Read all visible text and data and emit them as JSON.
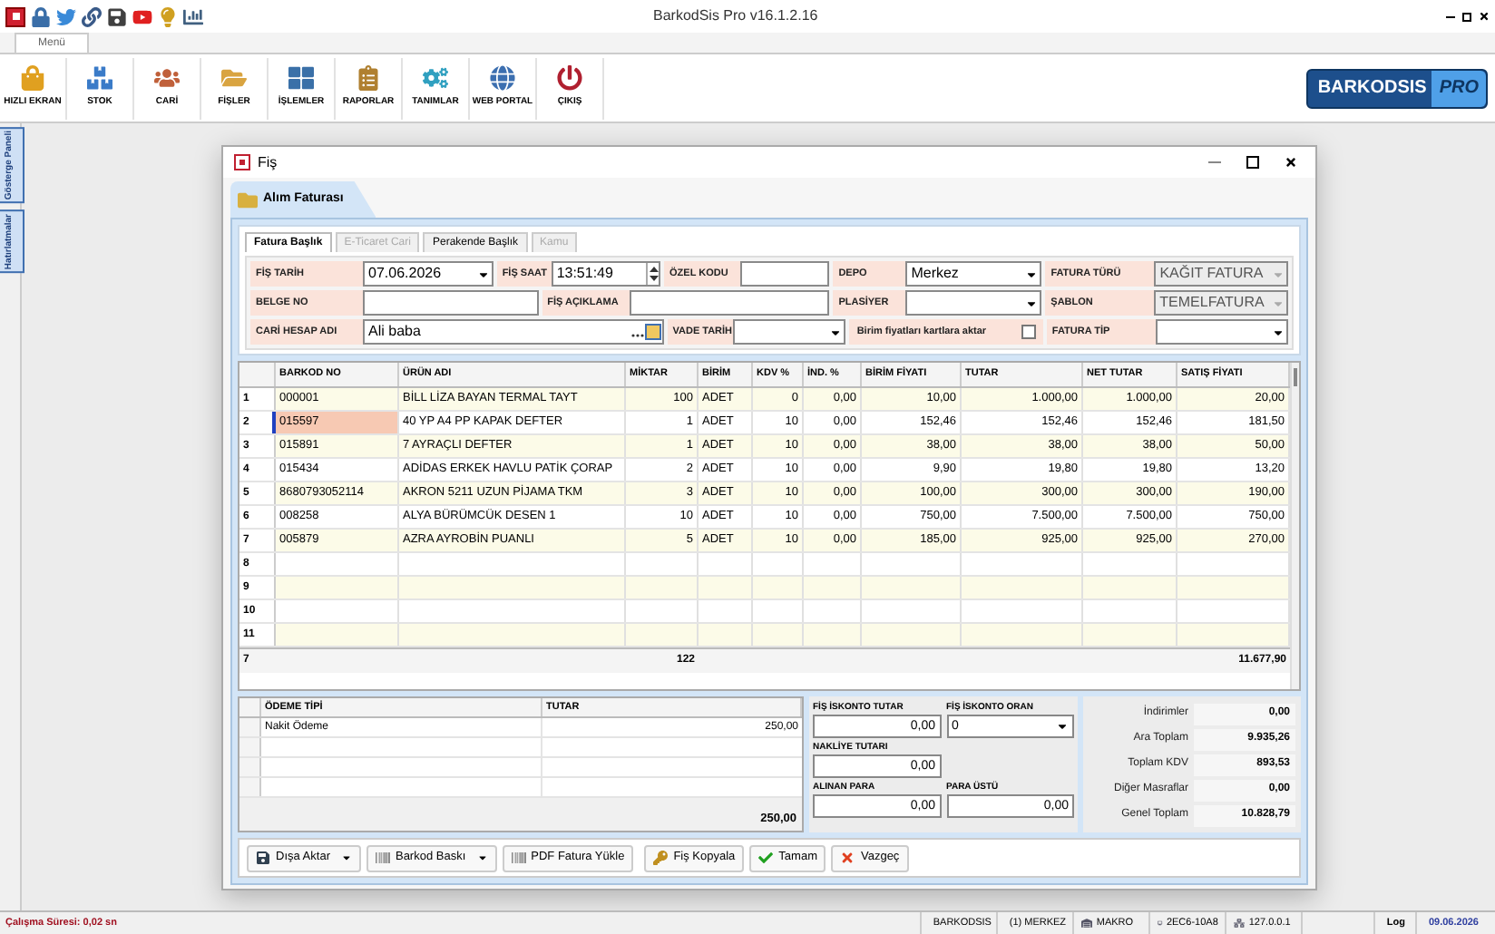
{
  "app": {
    "title": "BarkodSis Pro v16.1.2.16",
    "menu_tab": "Menü",
    "ribbon": [
      {
        "label": "HIZLI EKRAN"
      },
      {
        "label": "STOK"
      },
      {
        "label": "CARİ"
      },
      {
        "label": "FİŞLER"
      },
      {
        "label": "İŞLEMLER"
      },
      {
        "label": "RAPORLAR"
      },
      {
        "label": "TANIMLAR"
      },
      {
        "label": "WEB PORTAL"
      },
      {
        "label": "ÇIKIŞ"
      }
    ],
    "logo": {
      "brand": "BARKODSIS",
      "badge": "PRO"
    },
    "side_tabs": [
      "Gösterge Paneli",
      "Hatırlatmalar"
    ]
  },
  "window": {
    "title": "Fiş",
    "doc_tab": "Alım Faturası",
    "tabs": [
      {
        "label": "Fatura Başlık",
        "selected": true,
        "disabled": false
      },
      {
        "label": "E-Ticaret Cari",
        "selected": false,
        "disabled": true
      },
      {
        "label": "Perakende Başlık",
        "selected": false,
        "disabled": false
      },
      {
        "label": "Kamu",
        "selected": false,
        "disabled": true
      }
    ],
    "form": [
      [
        {
          "kind": "combo",
          "label": "FİŞ TARİH",
          "value": "07.06.2026",
          "disabled": false
        },
        {
          "kind": "spin",
          "label": "FİŞ SAAT",
          "value": "13:51:49",
          "disabled": false
        },
        {
          "kind": "text",
          "label": "ÖZEL KODU",
          "disabled": false
        },
        {
          "kind": "combo",
          "label": "DEPO",
          "value": "Merkez",
          "disabled": false
        },
        {
          "kind": "combo",
          "label": "FATURA TÜRÜ",
          "value": "KAĞIT FATURA",
          "disabled": true
        }
      ],
      [
        {
          "kind": "text",
          "label": "BELGE NO",
          "disabled": false
        },
        {
          "kind": "text",
          "label": "FİŞ AÇIKLAMA",
          "disabled": false
        },
        {
          "kind": "combo",
          "label": "PLASİYER",
          "disabled": false
        },
        {
          "kind": "combo",
          "label": "ŞABLON",
          "value": "TEMELFATURA",
          "disabled": true
        }
      ],
      [
        {
          "kind": "lookup",
          "label": "CARİ HESAP ADI",
          "value": "Ali baba",
          "disabled": false
        },
        {
          "kind": "combo",
          "label": "VADE TARİH",
          "disabled": false
        },
        {
          "kind": "checkbox",
          "label": "Birim fiyatları kartlara aktar",
          "checked": false,
          "disabled": false
        },
        {
          "kind": "combo",
          "label": "FATURA TİP",
          "disabled": false
        }
      ]
    ],
    "grid": {
      "columns": [
        "BARKOD NO",
        "ÜRÜN ADI",
        "MİKTAR",
        "BİRİM",
        "KDV %",
        "İND. %",
        "BİRİM FİYATI",
        "TUTAR",
        "NET TUTAR",
        "SATIŞ FİYATI"
      ],
      "rows": [
        {
          "number": "1",
          "selected": false,
          "cells": [
            "000001",
            "BİLL LİZA BAYAN TERMAL TAYT",
            "100",
            "ADET",
            "0",
            "0,00",
            "10,00",
            "1.000,00",
            "1.000,00",
            "20,00"
          ]
        },
        {
          "number": "2",
          "selected": true,
          "cells": [
            "015597",
            "40 YP A4 PP KAPAK DEFTER",
            "1",
            "ADET",
            "10",
            "0,00",
            "152,46",
            "152,46",
            "152,46",
            "181,50"
          ]
        },
        {
          "number": "3",
          "selected": false,
          "cells": [
            "015891",
            "7 AYRAÇLI DEFTER",
            "1",
            "ADET",
            "10",
            "0,00",
            "38,00",
            "38,00",
            "38,00",
            "50,00"
          ]
        },
        {
          "number": "4",
          "selected": false,
          "cells": [
            "015434",
            "ADİDAS ERKEK HAVLU PATİK ÇORAP",
            "2",
            "ADET",
            "10",
            "0,00",
            "9,90",
            "19,80",
            "19,80",
            "13,20"
          ]
        },
        {
          "number": "5",
          "selected": false,
          "cells": [
            "8680793052114",
            "AKRON 5211 UZUN PİJAMA TKM",
            "3",
            "ADET",
            "10",
            "0,00",
            "100,00",
            "300,00",
            "300,00",
            "190,00"
          ]
        },
        {
          "number": "6",
          "selected": false,
          "cells": [
            "008258",
            "ALYA BÜRÜMCÜK DESEN  1",
            "10",
            "ADET",
            "10",
            "0,00",
            "750,00",
            "7.500,00",
            "7.500,00",
            "750,00"
          ]
        },
        {
          "number": "7",
          "selected": false,
          "cells": [
            "005879",
            "AZRA AYROBİN PUANLI",
            "5",
            "ADET",
            "10",
            "0,00",
            "185,00",
            "925,00",
            "925,00",
            "270,00"
          ]
        },
        {
          "number": "8",
          "selected": false
        },
        {
          "number": "9",
          "selected": false
        },
        {
          "number": "10",
          "selected": false
        },
        {
          "number": "11",
          "selected": false
        }
      ],
      "footer": {
        "count": "7",
        "quantity": "122",
        "sales_total": "11.677,90"
      }
    },
    "payments": {
      "columns": [
        "ÖDEME TİPİ",
        "TUTAR"
      ],
      "rows": [
        [
          "Nakit Ödeme",
          "250,00"
        ]
      ],
      "total": "250,00"
    },
    "discounts": [
      {
        "label": "FİŞ İSKONTO TUTAR",
        "value": "0,00",
        "kind": "number"
      },
      {
        "label": "FİŞ İSKONTO ORAN",
        "value": "0",
        "kind": "combo"
      },
      {
        "label": "NAKLİYE TUTARI",
        "value": "0,00",
        "kind": "number"
      },
      {
        "kind": "blank"
      },
      {
        "label": "ALINAN PARA",
        "value": "0,00",
        "kind": "number"
      },
      {
        "label": "PARA ÜSTÜ",
        "value": "0,00",
        "kind": "number"
      }
    ],
    "summary": [
      {
        "label": "İndirimler",
        "value": "0,00"
      },
      {
        "label": "Ara Toplam",
        "value": "9.935,26"
      },
      {
        "label": "Toplam KDV",
        "value": "893,53"
      },
      {
        "label": "Diğer Masraflar",
        "value": "0,00"
      },
      {
        "label": "Genel Toplam",
        "value": "10.828,79"
      }
    ],
    "buttons": [
      {
        "label": "Dışa Aktar",
        "dropdown": true
      },
      {
        "label": "Barkod Baskı",
        "dropdown": true
      },
      {
        "label": "PDF Fatura Yükle",
        "dropdown": false
      },
      {
        "label": "Fiş Kopyala",
        "dropdown": false
      },
      {
        "label": "Tamam",
        "dropdown": false
      },
      {
        "label": "Vazgeç",
        "dropdown": false
      }
    ]
  },
  "status_bar": {
    "runtime": "Çalışma Süresi: 0,02 sn",
    "items": [
      "BARKODSIS",
      "(1) MERKEZ",
      "MAKRO",
      "2EC6-10A8",
      "127.0.0.1"
    ],
    "log": "Log",
    "date": "09.06.2026"
  }
}
